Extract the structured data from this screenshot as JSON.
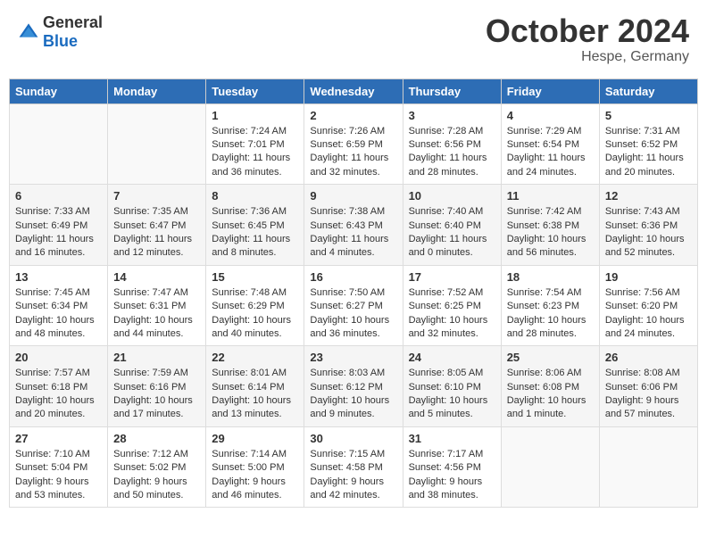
{
  "logo": {
    "text_general": "General",
    "text_blue": "Blue"
  },
  "header": {
    "month": "October 2024",
    "location": "Hespe, Germany"
  },
  "days_of_week": [
    "Sunday",
    "Monday",
    "Tuesday",
    "Wednesday",
    "Thursday",
    "Friday",
    "Saturday"
  ],
  "weeks": [
    [
      {
        "day": "",
        "info": ""
      },
      {
        "day": "",
        "info": ""
      },
      {
        "day": "1",
        "info": "Sunrise: 7:24 AM\nSunset: 7:01 PM\nDaylight: 11 hours and 36 minutes."
      },
      {
        "day": "2",
        "info": "Sunrise: 7:26 AM\nSunset: 6:59 PM\nDaylight: 11 hours and 32 minutes."
      },
      {
        "day": "3",
        "info": "Sunrise: 7:28 AM\nSunset: 6:56 PM\nDaylight: 11 hours and 28 minutes."
      },
      {
        "day": "4",
        "info": "Sunrise: 7:29 AM\nSunset: 6:54 PM\nDaylight: 11 hours and 24 minutes."
      },
      {
        "day": "5",
        "info": "Sunrise: 7:31 AM\nSunset: 6:52 PM\nDaylight: 11 hours and 20 minutes."
      }
    ],
    [
      {
        "day": "6",
        "info": "Sunrise: 7:33 AM\nSunset: 6:49 PM\nDaylight: 11 hours and 16 minutes."
      },
      {
        "day": "7",
        "info": "Sunrise: 7:35 AM\nSunset: 6:47 PM\nDaylight: 11 hours and 12 minutes."
      },
      {
        "day": "8",
        "info": "Sunrise: 7:36 AM\nSunset: 6:45 PM\nDaylight: 11 hours and 8 minutes."
      },
      {
        "day": "9",
        "info": "Sunrise: 7:38 AM\nSunset: 6:43 PM\nDaylight: 11 hours and 4 minutes."
      },
      {
        "day": "10",
        "info": "Sunrise: 7:40 AM\nSunset: 6:40 PM\nDaylight: 11 hours and 0 minutes."
      },
      {
        "day": "11",
        "info": "Sunrise: 7:42 AM\nSunset: 6:38 PM\nDaylight: 10 hours and 56 minutes."
      },
      {
        "day": "12",
        "info": "Sunrise: 7:43 AM\nSunset: 6:36 PM\nDaylight: 10 hours and 52 minutes."
      }
    ],
    [
      {
        "day": "13",
        "info": "Sunrise: 7:45 AM\nSunset: 6:34 PM\nDaylight: 10 hours and 48 minutes."
      },
      {
        "day": "14",
        "info": "Sunrise: 7:47 AM\nSunset: 6:31 PM\nDaylight: 10 hours and 44 minutes."
      },
      {
        "day": "15",
        "info": "Sunrise: 7:48 AM\nSunset: 6:29 PM\nDaylight: 10 hours and 40 minutes."
      },
      {
        "day": "16",
        "info": "Sunrise: 7:50 AM\nSunset: 6:27 PM\nDaylight: 10 hours and 36 minutes."
      },
      {
        "day": "17",
        "info": "Sunrise: 7:52 AM\nSunset: 6:25 PM\nDaylight: 10 hours and 32 minutes."
      },
      {
        "day": "18",
        "info": "Sunrise: 7:54 AM\nSunset: 6:23 PM\nDaylight: 10 hours and 28 minutes."
      },
      {
        "day": "19",
        "info": "Sunrise: 7:56 AM\nSunset: 6:20 PM\nDaylight: 10 hours and 24 minutes."
      }
    ],
    [
      {
        "day": "20",
        "info": "Sunrise: 7:57 AM\nSunset: 6:18 PM\nDaylight: 10 hours and 20 minutes."
      },
      {
        "day": "21",
        "info": "Sunrise: 7:59 AM\nSunset: 6:16 PM\nDaylight: 10 hours and 17 minutes."
      },
      {
        "day": "22",
        "info": "Sunrise: 8:01 AM\nSunset: 6:14 PM\nDaylight: 10 hours and 13 minutes."
      },
      {
        "day": "23",
        "info": "Sunrise: 8:03 AM\nSunset: 6:12 PM\nDaylight: 10 hours and 9 minutes."
      },
      {
        "day": "24",
        "info": "Sunrise: 8:05 AM\nSunset: 6:10 PM\nDaylight: 10 hours and 5 minutes."
      },
      {
        "day": "25",
        "info": "Sunrise: 8:06 AM\nSunset: 6:08 PM\nDaylight: 10 hours and 1 minute."
      },
      {
        "day": "26",
        "info": "Sunrise: 8:08 AM\nSunset: 6:06 PM\nDaylight: 9 hours and 57 minutes."
      }
    ],
    [
      {
        "day": "27",
        "info": "Sunrise: 7:10 AM\nSunset: 5:04 PM\nDaylight: 9 hours and 53 minutes."
      },
      {
        "day": "28",
        "info": "Sunrise: 7:12 AM\nSunset: 5:02 PM\nDaylight: 9 hours and 50 minutes."
      },
      {
        "day": "29",
        "info": "Sunrise: 7:14 AM\nSunset: 5:00 PM\nDaylight: 9 hours and 46 minutes."
      },
      {
        "day": "30",
        "info": "Sunrise: 7:15 AM\nSunset: 4:58 PM\nDaylight: 9 hours and 42 minutes."
      },
      {
        "day": "31",
        "info": "Sunrise: 7:17 AM\nSunset: 4:56 PM\nDaylight: 9 hours and 38 minutes."
      },
      {
        "day": "",
        "info": ""
      },
      {
        "day": "",
        "info": ""
      }
    ]
  ]
}
